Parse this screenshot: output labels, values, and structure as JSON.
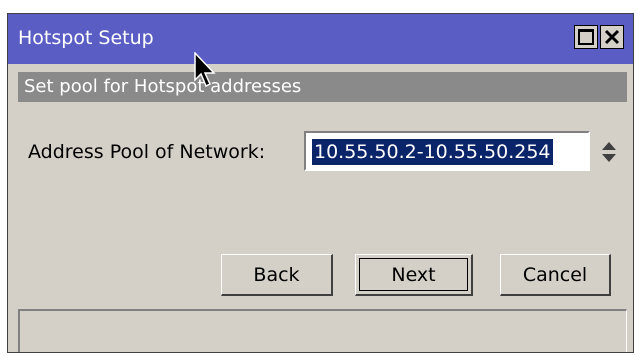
{
  "window": {
    "title": "Hotspot Setup",
    "maximize_icon": "maximize-icon",
    "close_icon": "close-icon"
  },
  "subtitle": "Set pool for Hotspot addresses",
  "form": {
    "pool_label": "Address Pool of Network:",
    "pool_value": "10.55.50.2-10.55.50.254",
    "spinner_icon": "up-down-arrows-icon"
  },
  "buttons": {
    "back": "Back",
    "next": "Next",
    "cancel": "Cancel"
  },
  "status": "",
  "colors": {
    "titlebar": "#5a5ec4",
    "subtitle_bar": "#8a8a8a",
    "dialog_bg": "#d4d0c8",
    "selection": "#0a246a"
  }
}
